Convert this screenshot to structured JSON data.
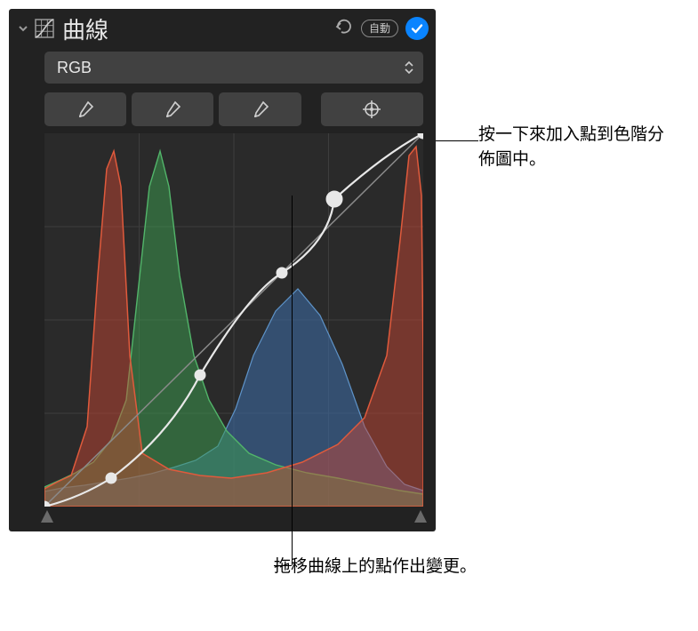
{
  "header": {
    "title": "曲線",
    "auto_label": "自動"
  },
  "channel_select": {
    "value": "RGB"
  },
  "callouts": {
    "add_point": "按一下來加入點到色階分佈圖中。",
    "drag_point": "拖移曲線上的點作出變更。"
  },
  "chart_data": {
    "type": "line",
    "title": "",
    "xlabel": "",
    "ylabel": "",
    "xlim": [
      0,
      255
    ],
    "ylim": [
      0,
      255
    ],
    "curve_points_xy": [
      [
        0,
        0
      ],
      [
        45,
        20
      ],
      [
        105,
        90
      ],
      [
        160,
        160
      ],
      [
        195,
        210
      ],
      [
        255,
        255
      ]
    ],
    "diagonal_reference": [
      [
        0,
        0
      ],
      [
        255,
        255
      ]
    ],
    "histograms": {
      "note": "approximate channel histogram heights (0–100) across 0–255 input",
      "x": [
        0,
        15,
        30,
        45,
        55,
        70,
        85,
        95,
        110,
        125,
        140,
        160,
        180,
        200,
        220,
        235,
        245,
        252,
        255
      ],
      "red": [
        5,
        8,
        10,
        60,
        90,
        18,
        12,
        10,
        9,
        8,
        8,
        10,
        12,
        14,
        20,
        30,
        55,
        95,
        60
      ],
      "green": [
        6,
        10,
        12,
        20,
        28,
        40,
        95,
        60,
        35,
        22,
        16,
        14,
        12,
        10,
        9,
        8,
        7,
        6,
        5
      ],
      "blue": [
        4,
        6,
        7,
        9,
        10,
        12,
        14,
        16,
        20,
        28,
        45,
        65,
        72,
        60,
        40,
        22,
        12,
        8,
        6
      ]
    }
  }
}
